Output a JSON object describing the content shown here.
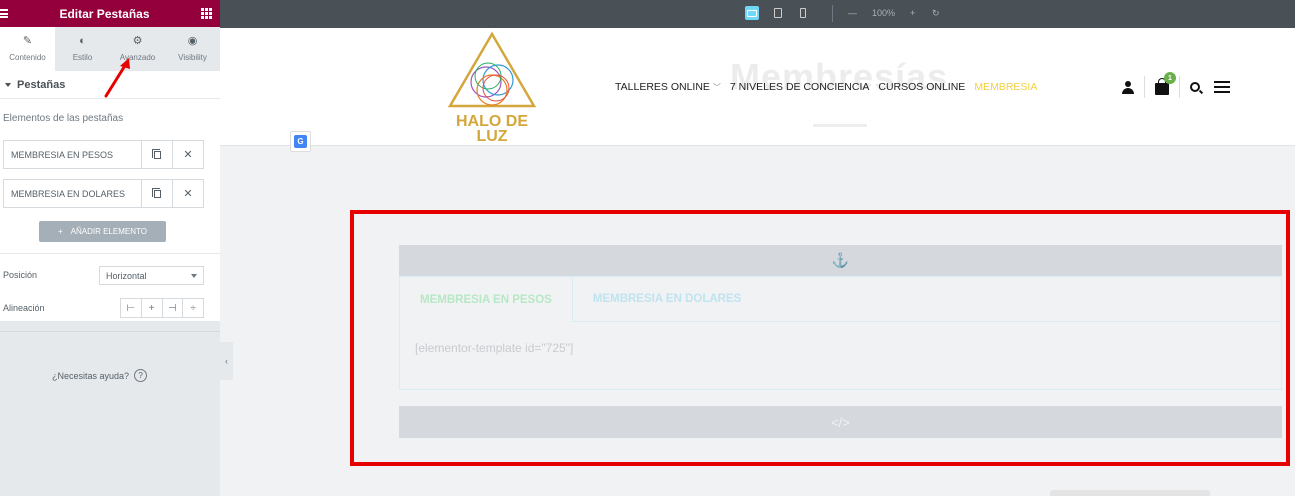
{
  "panel": {
    "title": "Editar Pestañas",
    "tabs": [
      {
        "label": "Contenido",
        "icon": "pencil-icon"
      },
      {
        "label": "Estilo",
        "icon": "half-circle-icon"
      },
      {
        "label": "Avanzado",
        "icon": "gear-icon"
      },
      {
        "label": "Visibility",
        "icon": "eye-icon"
      }
    ],
    "active_tab": "Contenido",
    "section_title": "Pestañas",
    "items_label": "Elementos de las pestañas",
    "items": [
      {
        "label": "MEMBRESIA EN PESOS"
      },
      {
        "label": "MEMBRESIA EN DOLARES"
      }
    ],
    "add_button": "AÑADIR ELEMENTO",
    "position_label": "Posición",
    "position_value": "Horizontal",
    "alignment_label": "Alineación",
    "help_text": "¿Necesitas ayuda?",
    "accent_color": "#93003c"
  },
  "topbar": {
    "zoom": "100%",
    "minus": "—",
    "plus": "+",
    "undo": "↻"
  },
  "site": {
    "logo_text_1": "HALO DE",
    "logo_text_2": "LUZ",
    "ghost_title": "Membresías",
    "nav": [
      "TALLERES ONLINE",
      "7 NIVELES DE CONCIENCIA",
      "CURSOS ONLINE",
      "MEMBRESIA"
    ],
    "cart_count": "1"
  },
  "widget": {
    "tabs": [
      "MEMBRESIA EN PESOS",
      "MEMBRESIA EN DOLARES"
    ],
    "content": "[elementor-template id=\"725\"]"
  }
}
